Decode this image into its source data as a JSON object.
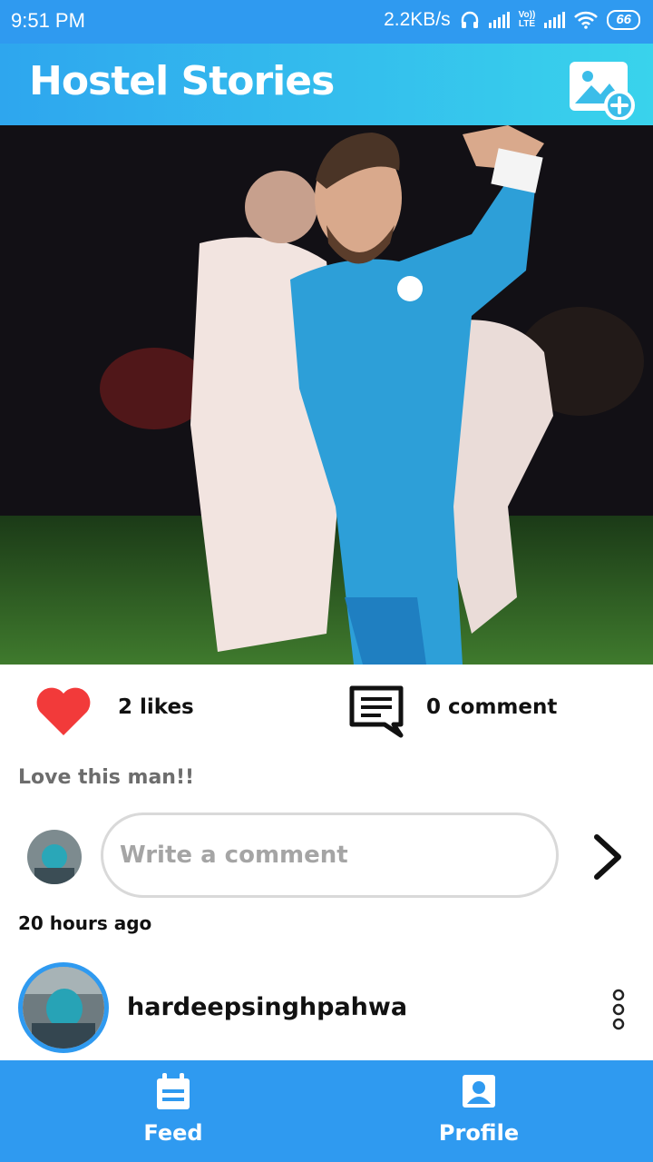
{
  "status_bar": {
    "time": "9:51 PM",
    "speed": "2.2KB/s",
    "lte_top": "Vo))",
    "lte_bottom": "LTE",
    "battery": "66"
  },
  "app_bar": {
    "title": "Hostel Stories",
    "add_icon": "add-photo-icon"
  },
  "post": {
    "likes": "2 likes",
    "comments": "0 comment",
    "caption": "Love this man!!",
    "comment_placeholder": "Write a comment",
    "time_ago": "20 hours ago",
    "like_color": "#f23a3a"
  },
  "next_post": {
    "username": "hardeepsinghpahwa"
  },
  "bottom_nav": {
    "items": [
      {
        "label": "Feed",
        "icon": "calendar-icon"
      },
      {
        "label": "Profile",
        "icon": "profile-icon"
      }
    ]
  },
  "colors": {
    "primary": "#2f9af0",
    "appbar_gradient_end": "#39d3ec"
  }
}
